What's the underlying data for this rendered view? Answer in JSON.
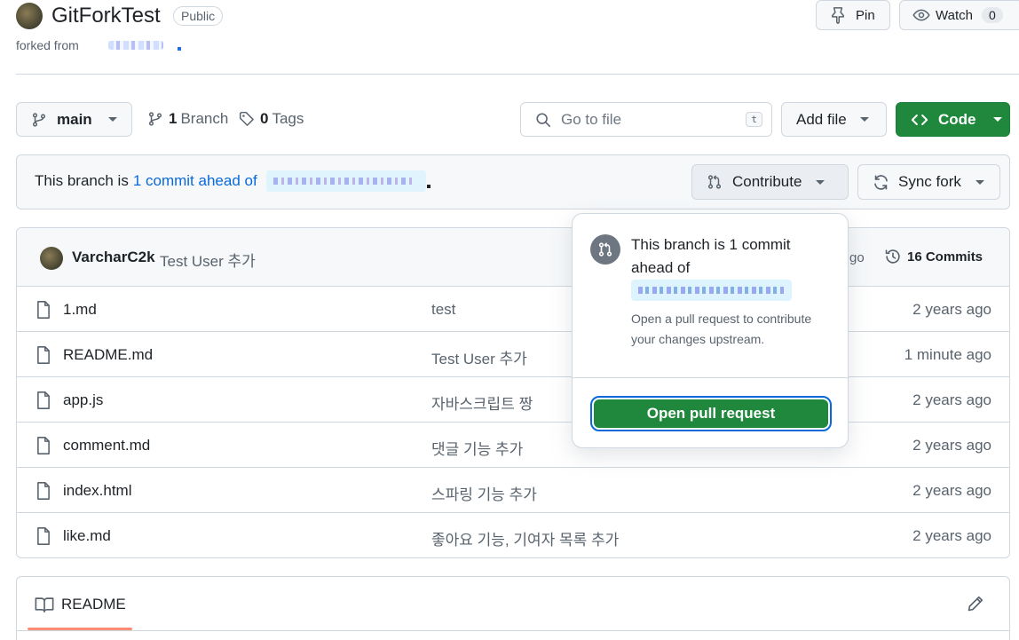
{
  "repo": {
    "name": "GitForkTest",
    "visibility": "Public",
    "forked_from_label": "forked from",
    "forked_from_value": "upstream/repo"
  },
  "actions": {
    "pin_label": "Pin",
    "watch_label": "Watch",
    "watch_count": "0"
  },
  "toolbar": {
    "branch_name": "main",
    "branches_count": "1",
    "branches_label": "Branch",
    "tags_count": "0",
    "tags_label": "Tags",
    "search_placeholder": "Go to file",
    "search_shortcut": "t",
    "add_file_label": "Add file",
    "code_label": "Code"
  },
  "banner": {
    "prefix": "This branch is",
    "link_text": "1 commit ahead of",
    "contribute_label": "Contribute",
    "sync_fork_label": "Sync fork"
  },
  "latest_commit": {
    "author": "VarcharC2k",
    "message": "Test User 추가",
    "time_fragment": "go",
    "commits_count_label": "16 Commits"
  },
  "files": [
    {
      "name": "1.md",
      "message": "test",
      "age": "2 years ago"
    },
    {
      "name": "README.md",
      "message": "Test User 추가",
      "age": "1 minute ago"
    },
    {
      "name": "app.js",
      "message": "자바스크립트 짱",
      "age": "2 years ago"
    },
    {
      "name": "comment.md",
      "message": "댓글 기능 추가",
      "age": "2 years ago"
    },
    {
      "name": "index.html",
      "message": "스파링 기능 추가",
      "age": "2 years ago"
    },
    {
      "name": "like.md",
      "message": "좋아요 기능, 기여자 목록 추가",
      "age": "2 years ago"
    }
  ],
  "readme": {
    "tab_label": "README"
  },
  "popover": {
    "title_line1": "This branch is 1 commit",
    "title_line2": "ahead of",
    "description_line1": "Open a pull request to contribute",
    "description_line2": "your changes upstream.",
    "button_label": "Open pull request"
  },
  "colors": {
    "primary_green": "#1f883d",
    "link_blue": "#0969da",
    "muted_text": "#59636e",
    "border": "#d0d7de",
    "readme_tab_underline": "#fd8c73"
  },
  "icons": [
    "pin-icon",
    "eye-icon",
    "branch-icon",
    "tag-icon",
    "search-icon",
    "code-icon",
    "pull-request-icon",
    "sync-icon",
    "history-icon",
    "file-icon",
    "book-icon",
    "pencil-icon"
  ]
}
